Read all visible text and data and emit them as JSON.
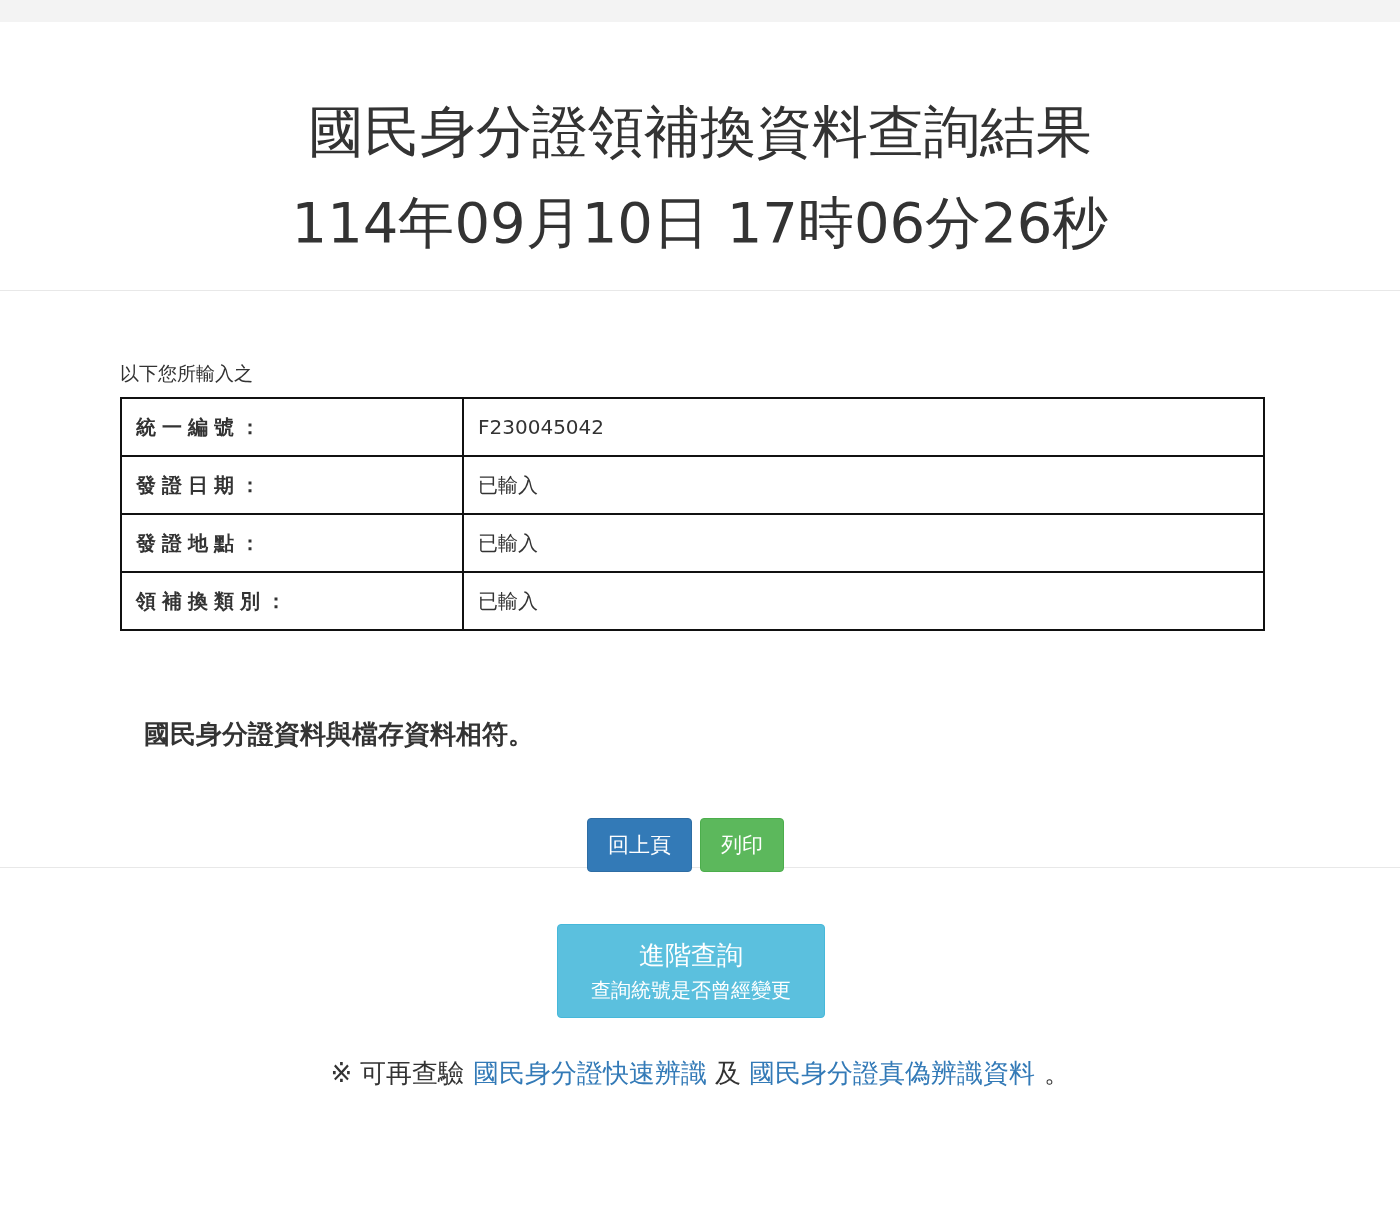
{
  "title": "國民身分證領補換資料查詢結果",
  "timestamp": "114年09月10日 17時06分26秒",
  "intro": "以下您所輸入之",
  "table": {
    "rows": [
      {
        "label": "統一編號：",
        "value": "F230045042"
      },
      {
        "label": "發證日期：",
        "value": "已輸入"
      },
      {
        "label": "發證地點：",
        "value": "已輸入"
      },
      {
        "label": "領補換類別：",
        "value": "已輸入"
      }
    ]
  },
  "result_message": "國民身分證資料與檔存資料相符。",
  "buttons": [
    {
      "label": "回上頁",
      "kind": "primary"
    },
    {
      "label": "列印",
      "kind": "success"
    }
  ],
  "advanced_button": {
    "label": "進階查詢",
    "sublabel": "查詢統號是否曾經變更"
  },
  "footer_note": {
    "prefix": "※ 可再查驗",
    "link_1": "國民身分證快速辨識",
    "middle": "及",
    "link_2": "國民身分證真偽辨識資料",
    "suffix": "。"
  }
}
